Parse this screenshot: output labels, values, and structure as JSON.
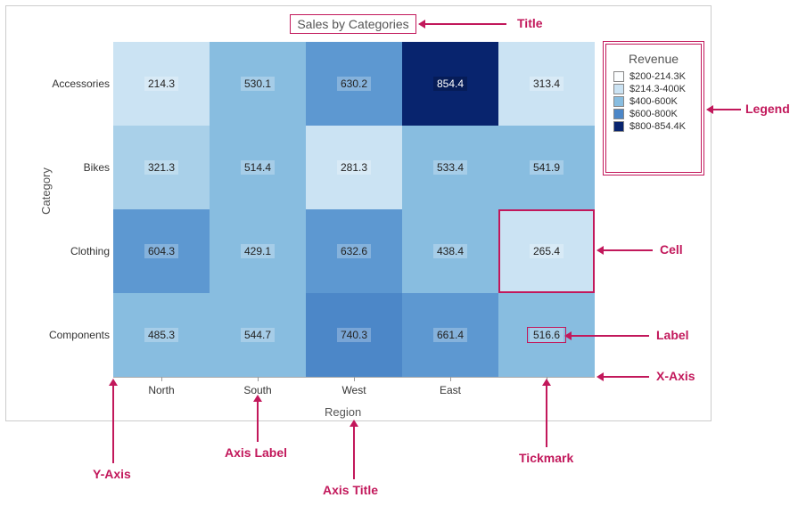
{
  "chart_data": {
    "type": "heatmap",
    "title": "Sales by Categories",
    "xlabel": "Region",
    "ylabel": "Category",
    "x_categories": [
      "North",
      "South",
      "West",
      "East",
      ""
    ],
    "y_categories": [
      "Accessories",
      "Bikes",
      "Clothing",
      "Components"
    ],
    "values": [
      [
        214.3,
        530.1,
        630.2,
        854.4,
        313.4
      ],
      [
        321.3,
        514.4,
        281.3,
        533.4,
        541.9
      ],
      [
        604.3,
        429.1,
        632.6,
        438.4,
        265.4
      ],
      [
        485.3,
        544.7,
        740.3,
        661.4,
        516.6
      ]
    ],
    "color_scale": {
      "name": "Revenue",
      "bins": [
        {
          "label": "$200-214.3K",
          "color": "#FBFDFE"
        },
        {
          "label": "$214.3-400K",
          "color": "#CBE3F3"
        },
        {
          "label": "$400-600K",
          "color": "#88BDE0"
        },
        {
          "label": "$600-800K",
          "color": "#4C87C8"
        },
        {
          "label": "$800-854.4K",
          "color": "#08246E"
        }
      ]
    }
  },
  "annotations": {
    "title": "Title",
    "legend": "Legend",
    "cell": "Cell",
    "label": "Label",
    "xaxis": "X-Axis",
    "yaxis": "Y-Axis",
    "axis_label": "Axis Label",
    "axis_title": "Axis Title",
    "tickmark": "Tickmark"
  }
}
